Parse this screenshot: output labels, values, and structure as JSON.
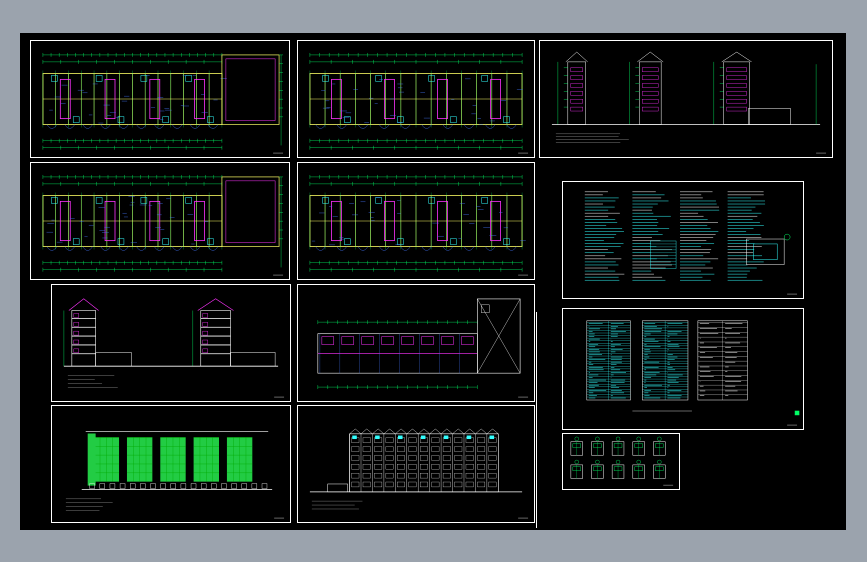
{
  "colors": {
    "canvas_bg": "#000000",
    "window_bg": "#9ba3ad",
    "frame": "#ffffff",
    "walls": "#ffff66",
    "dims": "#00ff66",
    "magenta": "#ff33ff",
    "cyan": "#33ffff",
    "blue": "#4477ff",
    "elevation_fill": "#22cc44"
  },
  "sheets": [
    {
      "id": "plan-1",
      "kind": "floor-plan-l"
    },
    {
      "id": "plan-2",
      "kind": "floor-plan"
    },
    {
      "id": "elevations-small",
      "kind": "elevations-side"
    },
    {
      "id": "plan-3",
      "kind": "floor-plan-l"
    },
    {
      "id": "plan-4",
      "kind": "floor-plan"
    },
    {
      "id": "notes",
      "kind": "notes"
    },
    {
      "id": "section",
      "kind": "section"
    },
    {
      "id": "roof-plan",
      "kind": "roof-plan"
    },
    {
      "id": "schedule",
      "kind": "table"
    },
    {
      "id": "elevation-front",
      "kind": "elevation-green"
    },
    {
      "id": "elevation-rear",
      "kind": "elevation-white"
    },
    {
      "id": "details",
      "kind": "details"
    }
  ]
}
